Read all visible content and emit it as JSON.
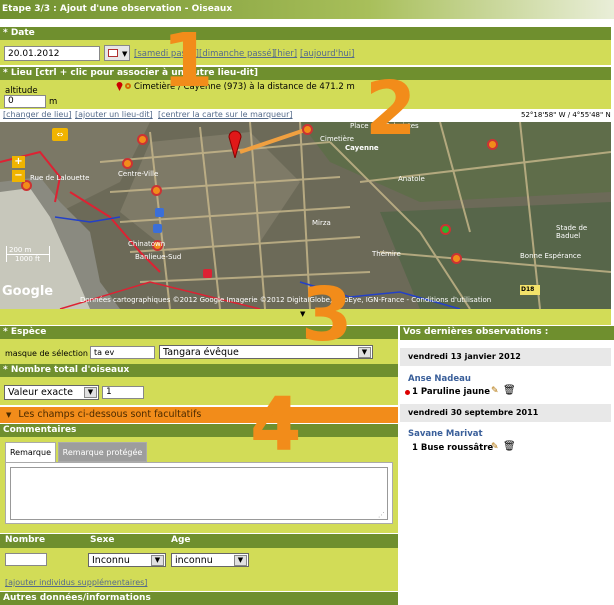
{
  "header": {
    "title": "Etape 3/3 : Ajout d'une observation - Oiseaux"
  },
  "date_section": {
    "title": "* Date",
    "value": "20.01.2012",
    "links": [
      "[samedi passé]",
      "[dimanche passé]",
      "[hier]",
      "[aujourd'hui]"
    ]
  },
  "place_section": {
    "title": "* Lieu [ctrl + clic pour associer à un autre lieu-dit]",
    "place_text": "Cimetière / Cayenne (973) à la distance de 471.2 m",
    "altitude_label": "altitude",
    "altitude_value": "0",
    "altitude_unit": "m",
    "links": [
      "[changer de lieu]",
      "[ajouter un lieu-dit]",
      "[centrer la carte sur le marqueur]"
    ],
    "coords": "52°18'58\" W / 4°55'48\" N"
  },
  "map": {
    "labels": [
      "Cimetière",
      "Place des Palmistes",
      "Cayenne",
      "Centre-Ville",
      "Chinatown",
      "Banlieue-Sud",
      "Rue de Lalouette",
      "Mirza",
      "Anatole",
      "Thémire",
      "Stade de Baduel",
      "Bonne Espérance"
    ],
    "scale_top": "200 m",
    "scale_bottom": "1000 ft",
    "google": "Google",
    "copyright": "Données cartographiques ©2012 Google Imagerie ©2012 DigitalGlobe, GeoEye, IGN-France - Conditions d'utilisation",
    "road_badge": "D18"
  },
  "annotations": [
    "1",
    "2",
    "3",
    "4"
  ],
  "species_section": {
    "title": "* Espèce",
    "mask_label": "masque de sélection",
    "mask_value": "ta ev",
    "selected": "Tangara évêque"
  },
  "count_section": {
    "title": "* Nombre total d'oiseaux",
    "mode": "Valeur exacte",
    "value": "1"
  },
  "optional_bar": {
    "label": "Les champs ci-dessous sont facultatifs"
  },
  "comments": {
    "title": "Commentaires",
    "tabs": [
      "Remarque",
      "Remarque protégée"
    ]
  },
  "individuals": {
    "col_nombre": "Nombre",
    "col_sexe": "Sexe",
    "col_age": "Age",
    "sexe_value": "Inconnu",
    "age_value": "inconnu",
    "add_link": "[ajouter individus supplémentaires]"
  },
  "other_data": {
    "title": "Autres données/informations"
  },
  "recent": {
    "title": "Vos dernières observations :",
    "groups": [
      {
        "date": "vendredi 13 janvier 2012",
        "place": "Anse Nadeau",
        "entry": "1 Paruline jaune"
      },
      {
        "date": "vendredi 30 septembre 2011",
        "place": "Savane Marivat",
        "entry": "1 Buse roussâtre"
      }
    ]
  },
  "colors": {
    "header_green": "#6f8f2e",
    "band_yellow": "#d2dc57",
    "orange": "#f28c1a"
  }
}
